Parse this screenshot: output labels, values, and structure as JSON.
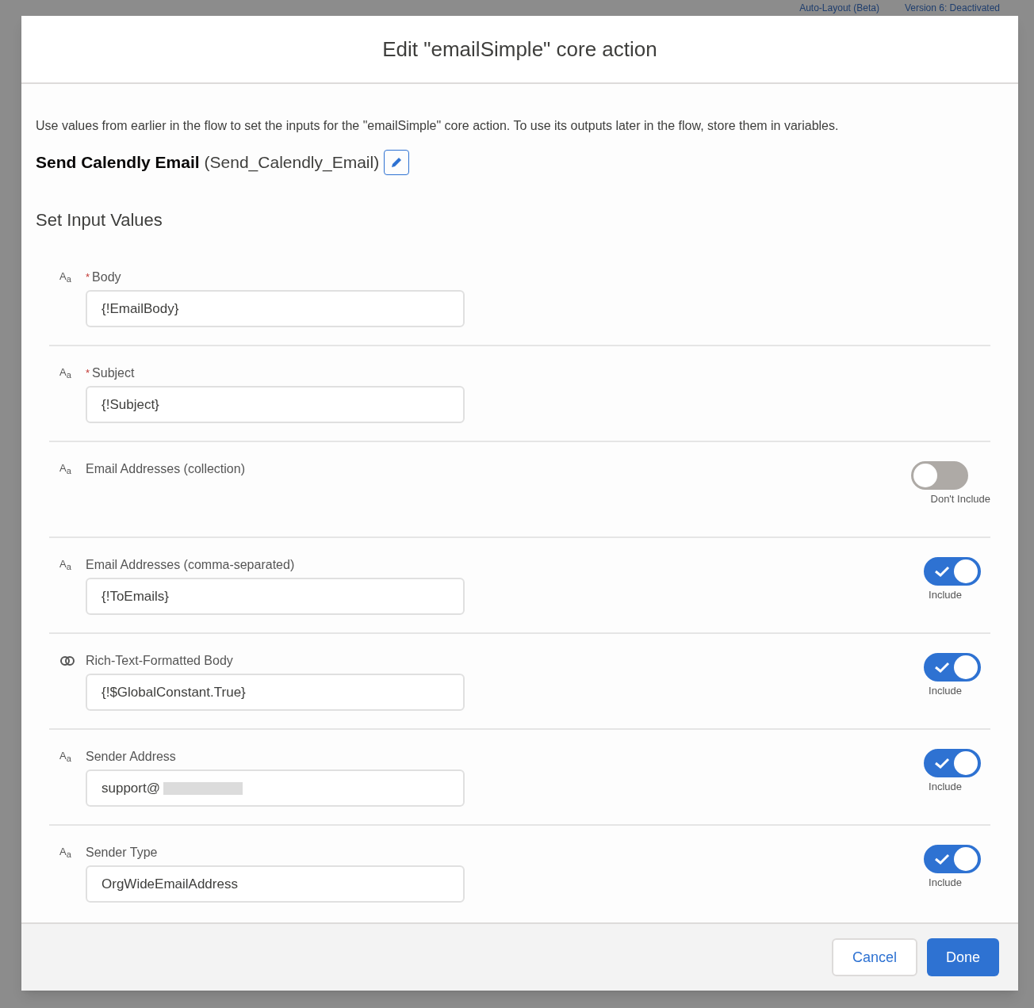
{
  "backdrop": {
    "texts": [
      "Auto-Layout (Beta)",
      "Version 6: Deactivated"
    ]
  },
  "dialog": {
    "title": "Edit \"emailSimple\" core action",
    "description": "Use values from earlier in the flow to set the inputs for the \"emailSimple\" core action. To use its outputs later in the flow, store them in variables.",
    "action_label": "Send Calendly Email",
    "action_api_name": "(Send_Calendly_Email)",
    "section_title": "Set Input Values",
    "fields": [
      {
        "kind": "text",
        "icon": {
          "main": "A",
          "sub": "a"
        },
        "required_marker": "*",
        "label": "Body",
        "value": "{!EmailBody}"
      },
      {
        "kind": "text",
        "icon": {
          "main": "A",
          "sub": "a"
        },
        "required_marker": "*",
        "label": "Subject",
        "value": "{!Subject}"
      },
      {
        "kind": "text",
        "icon": {
          "main": "A",
          "sub": "a"
        },
        "label": "Email Addresses (collection)",
        "toggle": {
          "on": false,
          "label": "Don't Include"
        }
      },
      {
        "kind": "text",
        "icon": {
          "main": "A",
          "sub": "a"
        },
        "label": "Email Addresses (comma-separated)",
        "value": "{!ToEmails}",
        "toggle": {
          "on": true,
          "label": "Include"
        }
      },
      {
        "kind": "boolean",
        "label": "Rich-Text-Formatted Body",
        "value": "{!$GlobalConstant.True}",
        "toggle": {
          "on": true,
          "label": "Include"
        }
      },
      {
        "kind": "text",
        "icon": {
          "main": "A",
          "sub": "a"
        },
        "label": "Sender Address",
        "value": "support@",
        "redacted": true,
        "toggle": {
          "on": true,
          "label": "Include"
        }
      },
      {
        "kind": "text",
        "icon": {
          "main": "A",
          "sub": "a"
        },
        "label": "Sender Type",
        "value": "OrgWideEmailAddress",
        "toggle": {
          "on": true,
          "label": "Include"
        }
      }
    ],
    "buttons": [
      {
        "label": "Cancel",
        "kind": "neutral"
      },
      {
        "label": "Done",
        "kind": "brand"
      }
    ]
  }
}
